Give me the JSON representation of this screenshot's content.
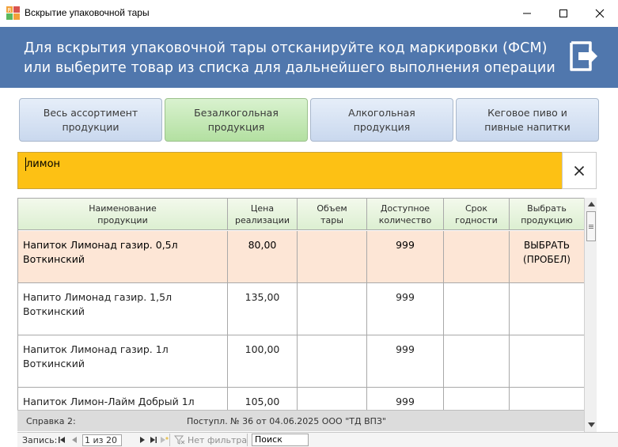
{
  "window": {
    "title": "Вскрытие упаковочной тары"
  },
  "banner": {
    "line1": "Для вскрытия упаковочной тары отсканируйте код маркировки (ФСМ)",
    "line2": "или выберите товар из списка для дальнейшего выполнения операции",
    "exit_icon": "exit-door-arrow-icon",
    "color": "#5077ad"
  },
  "categories": [
    {
      "label": "Весь ассортимент\nпродукции",
      "active": false
    },
    {
      "label": "Безалкогольная\nпродукция",
      "active": true
    },
    {
      "label": "Алкогольная\nпродукция",
      "active": false
    },
    {
      "label": "Кеговое пиво и\nпивные напитки",
      "active": false
    }
  ],
  "search": {
    "value": "лимон",
    "clear_icon": "close-icon",
    "color": "#fdc114"
  },
  "table": {
    "columns": [
      "Наименование\nпродукции",
      "Цена\nреализации",
      "Объем\nтары",
      "Доступное\nколичество",
      "Срок\nгодности",
      "Выбрать\nпродукцию"
    ],
    "rows": [
      {
        "name": "Напиток  Лимонад газир. 0,5л Воткинский",
        "price": "80,00",
        "volume": "",
        "qty": "999",
        "expiry": "",
        "select": "ВЫБРАТЬ (ПРОБЕЛ)",
        "selected": true
      },
      {
        "name": "Напито Лимонад газир. 1,5л Воткинский",
        "price": "135,00",
        "volume": "",
        "qty": "999",
        "expiry": "",
        "select": "",
        "selected": false
      },
      {
        "name": "Напиток  Лимонад газир. 1л Воткинский",
        "price": "100,00",
        "volume": "",
        "qty": "999",
        "expiry": "",
        "select": "",
        "selected": false
      },
      {
        "name": "Напиток  Лимон-Лайм  Добрый 1л",
        "price": "105,00",
        "volume": "",
        "qty": "999",
        "expiry": "",
        "select": "",
        "selected": false
      }
    ],
    "selected_row_color": "#fde6d6",
    "header_color": "#dcefd1"
  },
  "info": {
    "help_label": "Справка 2:",
    "receipt": "Поступл. № 36 от 04.06.2025 ООО \"ТД ВПЗ\""
  },
  "navigator": {
    "label": "Запись:",
    "record": "1 из 20",
    "filter": "Нет фильтра",
    "search_placeholder": "Поиск"
  }
}
